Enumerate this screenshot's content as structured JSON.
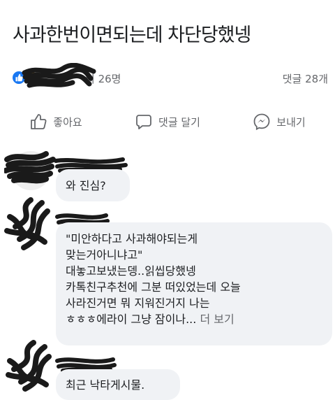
{
  "post": {
    "title": "사과한번이면되는데 차단당했넹"
  },
  "stats": {
    "reactions_text": "외 26명",
    "comments_text": "댓글 28개"
  },
  "actions": {
    "like_label": "좋아요",
    "comment_label": "댓글 달기",
    "send_label": "보내기"
  },
  "comments": [
    {
      "lines": [
        "와 진심?"
      ]
    },
    {
      "lines": [
        "\"미안하다고 사과해야되는게",
        "맞는거아니냐고\"",
        "대놓고보냈는뎅..읽씹당했넹",
        "카톡친구추천에 그분 떠있었는데 오늘",
        "사라진거면 뭐 지워진거지 나는"
      ],
      "last_line": "ㅎㅎㅎ에라이 그냥 잠이나...",
      "more_label": "더 보기"
    },
    {
      "lines": [
        "최근 낙타게시물."
      ]
    }
  ],
  "colors": {
    "accent": "#1877f2",
    "bubble": "#f0f2f5",
    "muted": "#65676b"
  }
}
